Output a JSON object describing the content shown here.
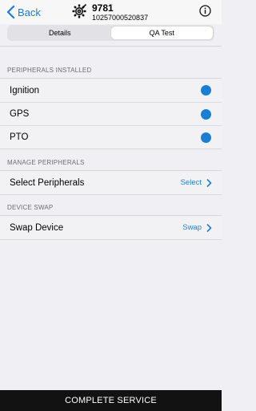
{
  "header": {
    "back_label": "Back",
    "asset_title": "9781",
    "asset_serial": "10257000520837"
  },
  "tabs": [
    {
      "label": "Details",
      "active": false
    },
    {
      "label": "QA Test",
      "active": true
    }
  ],
  "sections": {
    "peripherals_installed": {
      "title": "PERIPHERALS INSTALLED",
      "items": [
        {
          "label": "Ignition",
          "status_color": "#1a7fd4"
        },
        {
          "label": "GPS",
          "status_color": "#1a7fd4"
        },
        {
          "label": "PTO",
          "status_color": "#1a7fd4"
        }
      ]
    },
    "manage_peripherals": {
      "title": "MANAGE PERIPHERALS",
      "row_label": "Select Peripherals",
      "action_label": "Select"
    },
    "device_swap": {
      "title": "DEVICE SWAP",
      "row_label": "Swap Device",
      "action_label": "Swap"
    }
  },
  "footer": {
    "button_label": "COMPLETE SERVICE"
  },
  "colors": {
    "accent": "#1a7fd4",
    "background": "#efeff4",
    "footer_bg": "#121212"
  },
  "icons": [
    "chevron-left-icon",
    "gear-wrench-icon",
    "info-icon",
    "chevron-right-icon"
  ]
}
